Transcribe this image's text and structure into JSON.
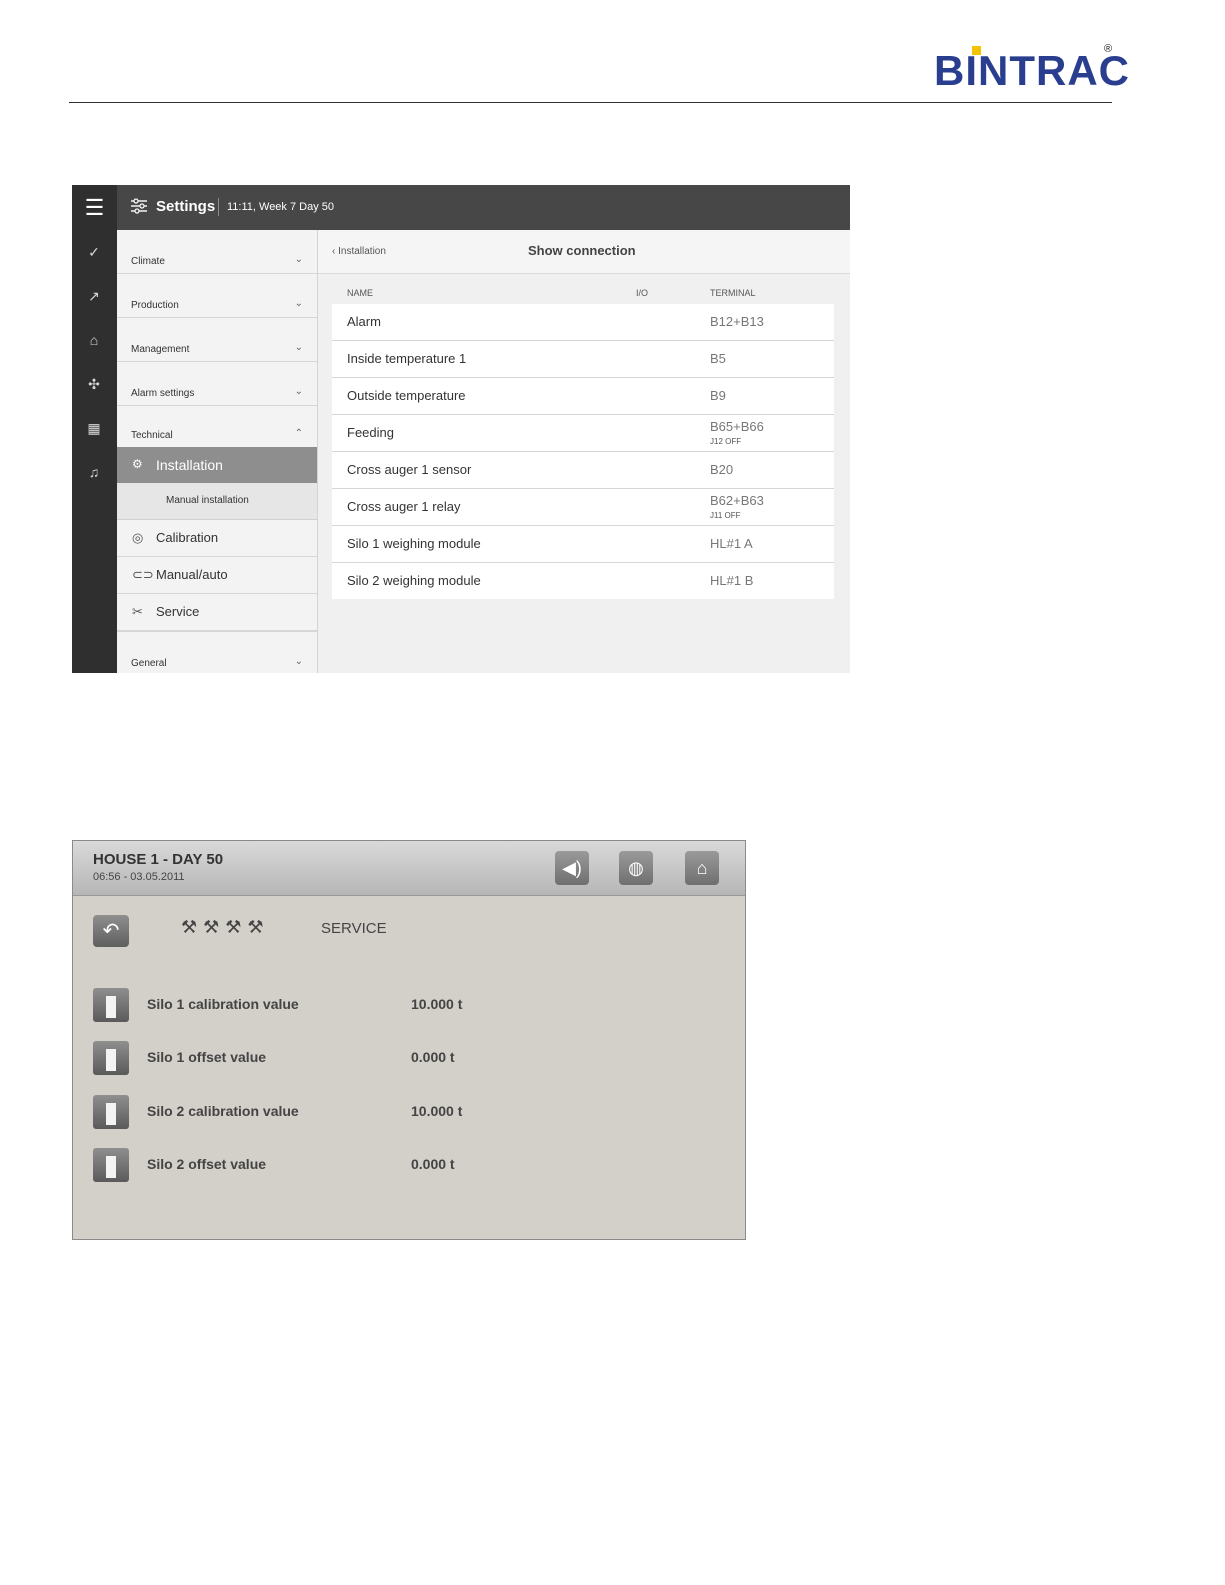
{
  "logo": {
    "text": "BINTRAC",
    "registered": "®"
  },
  "screen1": {
    "topbar": {
      "title": "Settings",
      "time": "11:11, Week 7 Day 50"
    },
    "rail_icons": [
      "dashboard-icon",
      "chart-icon",
      "house-icon",
      "fan-icon",
      "calendar-icon",
      "bell-icon"
    ],
    "nav": {
      "climate": "Climate",
      "production": "Production",
      "management": "Management",
      "alarm_settings": "Alarm settings",
      "technical": "Technical",
      "installation": "Installation",
      "manual_installation": "Manual installation",
      "calibration": "Calibration",
      "manual_auto": "Manual/auto",
      "service": "Service",
      "general": "General"
    },
    "content": {
      "back_label": "Installation",
      "title": "Show connection",
      "headers": {
        "name": "NAME",
        "io": "I/O",
        "terminal": "TERMINAL"
      },
      "rows": [
        {
          "name": "Alarm",
          "terminal": "B12+B13",
          "note": ""
        },
        {
          "name": "Inside temperature 1",
          "terminal": "B5",
          "note": ""
        },
        {
          "name": "Outside temperature",
          "terminal": "B9",
          "note": ""
        },
        {
          "name": "Feeding",
          "terminal": "B65+B66",
          "note": "J12 OFF"
        },
        {
          "name": "Cross auger 1 sensor",
          "terminal": "B20",
          "note": ""
        },
        {
          "name": "Cross auger 1 relay",
          "terminal": "B62+B63",
          "note": "J11 OFF"
        },
        {
          "name": "Silo 1 weighing module",
          "terminal": "HL#1 A",
          "note": ""
        },
        {
          "name": "Silo 2 weighing module",
          "terminal": "HL#1 B",
          "note": ""
        }
      ]
    }
  },
  "screen2": {
    "house": "HOUSE 1 - DAY 50",
    "datetime": "06:56 - 03.05.2011",
    "service_label": "SERVICE",
    "rows": [
      {
        "label": "Silo 1 calibration value",
        "value": "10.000 t"
      },
      {
        "label": "Silo 1 offset value",
        "value": "0.000 t"
      },
      {
        "label": "Silo 2 calibration value",
        "value": "10.000 t"
      },
      {
        "label": "Silo 2 offset value",
        "value": "0.000 t"
      }
    ]
  }
}
